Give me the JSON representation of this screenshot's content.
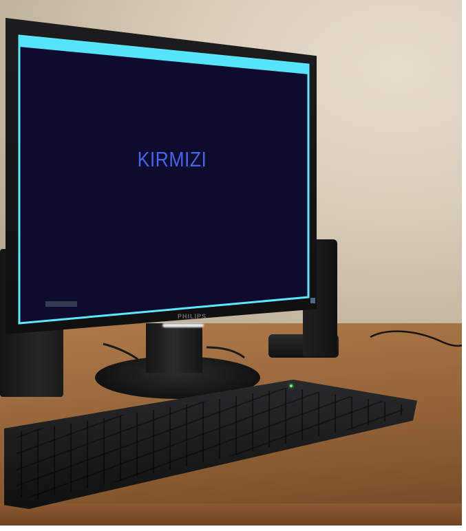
{
  "screen": {
    "word": "KIRMIZI",
    "word_color": "#4a62e8",
    "background_color": "#0d0c2e",
    "titlebar_color": "#55e4fa"
  },
  "monitor": {
    "brand": "PHILIPS"
  },
  "scene": {
    "icons": [
      "monitor-icon",
      "keyboard-icon",
      "speaker-icon"
    ]
  }
}
